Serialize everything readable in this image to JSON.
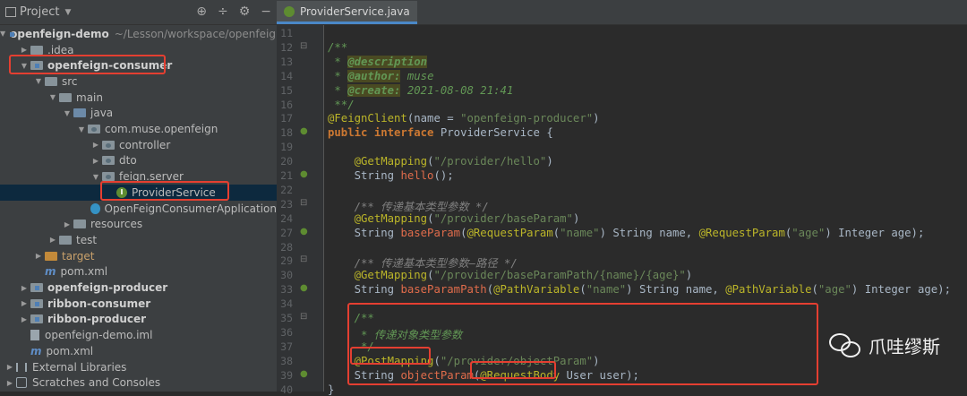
{
  "project_panel": {
    "title": "Project",
    "tree": [
      {
        "label": "openfeign-demo",
        "extra": "~/Lesson/workspace/openfeign",
        "icon": "module-folder-icon",
        "arrow": "▼",
        "depth": 0,
        "bold": true
      },
      {
        "label": ".idea",
        "icon": "folder-icon",
        "arrow": "▶",
        "depth": 1
      },
      {
        "label": "openfeign-consumer",
        "icon": "module-folder-icon",
        "arrow": "▼",
        "depth": 1,
        "bold": true
      },
      {
        "label": "src",
        "icon": "folder-icon",
        "arrow": "▼",
        "depth": 2
      },
      {
        "label": "main",
        "icon": "folder-icon",
        "arrow": "▼",
        "depth": 3
      },
      {
        "label": "java",
        "icon": "source-folder-icon",
        "arrow": "▼",
        "depth": 4
      },
      {
        "label": "com.muse.openfeign",
        "icon": "package-icon",
        "arrow": "▼",
        "depth": 5
      },
      {
        "label": "controller",
        "icon": "package-icon",
        "arrow": "▶",
        "depth": 6
      },
      {
        "label": "dto",
        "icon": "package-icon",
        "arrow": "▶",
        "depth": 6
      },
      {
        "label": "feign.server",
        "icon": "package-icon",
        "arrow": "▼",
        "depth": 6
      },
      {
        "label": "ProviderService",
        "icon": "interface-icon",
        "arrow": "",
        "depth": 7,
        "selected": true
      },
      {
        "label": "OpenFeignConsumerApplication",
        "icon": "class-icon",
        "arrow": "",
        "depth": 6
      },
      {
        "label": "resources",
        "icon": "folder-icon",
        "arrow": "▶",
        "depth": 4
      },
      {
        "label": "test",
        "icon": "folder-icon",
        "arrow": "▶",
        "depth": 3
      },
      {
        "label": "target",
        "icon": "excluded-folder-icon",
        "arrow": "▶",
        "depth": 2
      },
      {
        "label": "pom.xml",
        "icon": "maven-icon",
        "arrow": "",
        "depth": 2
      },
      {
        "label": "openfeign-producer",
        "icon": "module-folder-icon",
        "arrow": "▶",
        "depth": 1,
        "bold": true
      },
      {
        "label": "ribbon-consumer",
        "icon": "module-folder-icon",
        "arrow": "▶",
        "depth": 1,
        "bold": true
      },
      {
        "label": "ribbon-producer",
        "icon": "module-folder-icon",
        "arrow": "▶",
        "depth": 1,
        "bold": true
      },
      {
        "label": "openfeign-demo.iml",
        "icon": "iml-file-icon",
        "arrow": "",
        "depth": 1
      },
      {
        "label": "pom.xml",
        "icon": "maven-icon",
        "arrow": "",
        "depth": 1
      },
      {
        "label": "External Libraries",
        "icon": "libraries-icon",
        "arrow": "▶",
        "depth": 0
      },
      {
        "label": "Scratches and Consoles",
        "icon": "scratches-icon",
        "arrow": "▶",
        "depth": 0
      }
    ]
  },
  "editor": {
    "tab_label": "ProviderService.java",
    "lines": [
      {
        "n": "11",
        "html": ""
      },
      {
        "n": "12",
        "mark": "fold",
        "html": "<span class='doc'>/**</span>"
      },
      {
        "n": "13",
        "html": "<span class='doc'> * </span><span class='tag'>@description</span>"
      },
      {
        "n": "14",
        "html": "<span class='doc'> * </span><span class='tag'>@author:</span><span class='doc'> muse</span>"
      },
      {
        "n": "15",
        "html": "<span class='doc'> * </span><span class='tag'>@create:</span><span class='doc'> 2021-08-08 21:41</span>"
      },
      {
        "n": "16",
        "html": "<span class='doc'> **/</span>"
      },
      {
        "n": "17",
        "html": "<span class='ann'>@FeignClient</span>(name = <span class='str'>\"openfeign-producer\"</span>)"
      },
      {
        "n": "18",
        "mark": "impl",
        "html": "<span class='kw'>public interface</span> ProviderService {"
      },
      {
        "n": "19",
        "html": ""
      },
      {
        "n": "20",
        "html": "    <span class='ann'>@GetMapping</span>(<span class='str'>\"/provider/hello\"</span>)"
      },
      {
        "n": "21",
        "mark": "impl",
        "html": "    String <span class='meth'>hello</span>();"
      },
      {
        "n": "22",
        "html": ""
      },
      {
        "n": "23",
        "mark": "fold",
        "html": "    <span class='cmt'>/** 传递基本类型参数 */</span>"
      },
      {
        "n": "24",
        "html": "    <span class='ann'>@GetMapping</span>(<span class='str'>\"/provider/baseParam\"</span>)"
      },
      {
        "n": "27",
        "mark": "impl",
        "html": "    String <span class='meth'>baseParam</span>(<span class='ann'>@RequestParam</span>(<span class='str'>\"name\"</span>) String name, <span class='ann'>@RequestParam</span>(<span class='str'>\"age\"</span>) Integer age);"
      },
      {
        "n": "28",
        "html": ""
      },
      {
        "n": "29",
        "mark": "fold",
        "html": "    <span class='cmt'>/** 传递基本类型参数—路径 */</span>"
      },
      {
        "n": "30",
        "html": "    <span class='ann'>@GetMapping</span>(<span class='str'>\"/provider/baseParamPath/{name}/{age}\"</span>)"
      },
      {
        "n": "33",
        "mark": "impl",
        "html": "    String <span class='meth'>baseParamPath</span>(<span class='ann'>@PathVariable</span>(<span class='str'>\"name\"</span>) String name, <span class='ann'>@PathVariable</span>(<span class='str'>\"age\"</span>) Integer age);"
      },
      {
        "n": "34",
        "html": ""
      },
      {
        "n": "35",
        "mark": "fold",
        "html": "    <span class='doc'>/**</span>"
      },
      {
        "n": "36",
        "html": "<span class='doc'>     * 传递对象类型参数</span>"
      },
      {
        "n": "37",
        "html": "<span class='doc'>     */</span>"
      },
      {
        "n": "38",
        "html": "    <span class='ann'>@PostMapping</span>(<span class='str'>\"/provider/objectParam\"</span>)"
      },
      {
        "n": "39",
        "mark": "impl",
        "html": "    String <span class='meth'>objectParam</span>(<span class='ann'>@RequestBody</span> User user);"
      },
      {
        "n": "40",
        "html": "}"
      }
    ]
  },
  "watermark": "爪哇缪斯"
}
